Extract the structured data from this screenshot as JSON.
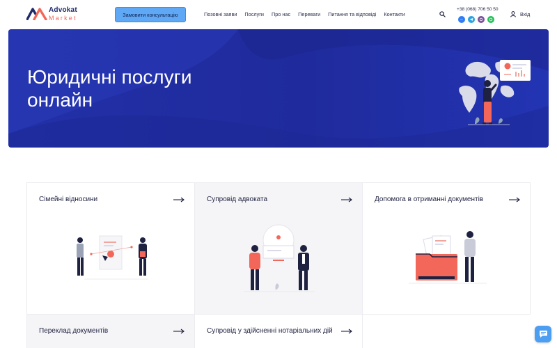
{
  "header": {
    "logo": {
      "line1": "Advokat",
      "line2": "Market"
    },
    "cta_label": "Замовити консультацію",
    "nav": [
      {
        "label": "Позовні заяви"
      },
      {
        "label": "Послуги"
      },
      {
        "label": "Про нас"
      },
      {
        "label": "Переваги"
      },
      {
        "label": "Питання та відповіді"
      },
      {
        "label": "Контакти"
      }
    ],
    "search_icon": "search-icon",
    "phone": "+38 (068) 706 50 50",
    "socials": [
      {
        "name": "messenger-icon",
        "color": "#2f7cf6"
      },
      {
        "name": "telegram-icon",
        "color": "#2aa3e0"
      },
      {
        "name": "viber-icon",
        "color": "#7b519d"
      },
      {
        "name": "whatsapp-icon",
        "color": "#25c15b"
      }
    ],
    "login_label": "Вхід",
    "login_icon": "user-icon"
  },
  "hero": {
    "title_line1": "Юридичні послуги",
    "title_line2": "онлайн",
    "background_color": "#2230a8",
    "accent_color": "#f2675a"
  },
  "services": [
    {
      "title": "Сімейні відносини",
      "illustration": "family-relations-illustration"
    },
    {
      "title": "Супровід адвоката",
      "illustration": "lawyer-support-illustration"
    },
    {
      "title": "Допомога в отриманні документів",
      "illustration": "documents-help-illustration"
    },
    {
      "title": "Переклад документів",
      "illustration": "translation-illustration"
    },
    {
      "title": "Супровід у здійсненні нотаріальних дій",
      "illustration": "notary-illustration"
    }
  ],
  "chat_widget": {
    "icon": "chat-icon",
    "color": "#4b9ef2"
  }
}
